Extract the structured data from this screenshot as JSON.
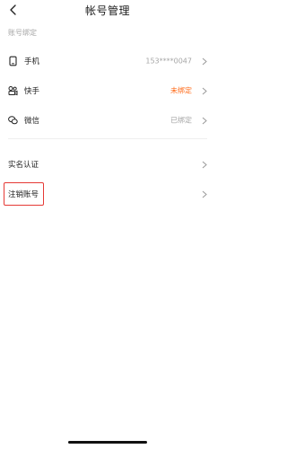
{
  "header": {
    "title": "帐号管理",
    "back_icon": "back-arrow-icon"
  },
  "binding_section": {
    "label": "账号绑定",
    "items": [
      {
        "label": "手机",
        "value": "153****0047",
        "icon": "phone-icon",
        "status": "bound"
      },
      {
        "label": "快手",
        "value": "未绑定",
        "icon": "kuaishou-icon",
        "status": "unbound"
      },
      {
        "label": "微信",
        "value": "已绑定",
        "icon": "wechat-icon",
        "status": "bound"
      }
    ]
  },
  "account_section": {
    "items": [
      {
        "label": "实名认证"
      },
      {
        "label": "注销账号"
      }
    ]
  },
  "colors": {
    "warning": "#ff6b1a",
    "muted": "#a6a6a6",
    "highlight_border": "#e53935"
  }
}
